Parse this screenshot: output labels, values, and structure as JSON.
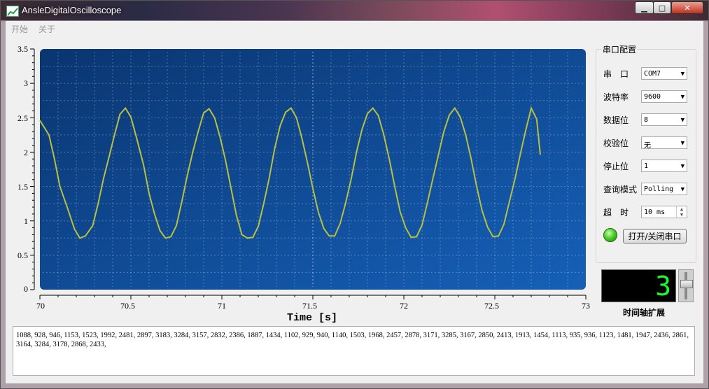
{
  "window": {
    "title": "AnsleDigitalOscilloscope",
    "minimize": "▁",
    "maximize": "□",
    "close": "✕"
  },
  "menu": {
    "items": [
      "开始",
      "关于"
    ]
  },
  "plot": {
    "x_label": "Time [s]",
    "x_ticks": [
      "70",
      "70.5",
      "71",
      "71.5",
      "72",
      "72.5",
      "73"
    ],
    "y_ticks": [
      "3.5",
      "3",
      "2.5",
      "2",
      "1.5",
      "1",
      "0.5",
      "0"
    ],
    "background": "#0a4a8c",
    "trace_color": "#b8c040"
  },
  "chart_data": {
    "type": "line",
    "xlabel": "Time [s]",
    "ylabel": "",
    "xlim": [
      70,
      73
    ],
    "ylim": [
      0,
      3.5
    ],
    "grid": true,
    "series": [
      {
        "x": [
          70.0,
          70.05,
          70.08,
          70.11,
          70.15,
          70.19,
          70.22,
          70.25,
          70.29,
          70.32,
          70.35,
          70.38,
          70.41,
          70.44,
          70.47,
          70.5,
          70.53,
          70.57,
          70.6,
          70.63,
          70.66,
          70.69,
          70.72,
          70.75,
          70.78,
          70.81,
          70.84,
          70.87,
          70.9,
          70.93,
          70.96,
          70.99,
          71.02,
          71.05,
          71.08,
          71.11,
          71.14,
          71.17,
          71.2,
          71.23,
          71.26,
          71.29,
          71.32,
          71.35,
          71.38,
          71.41,
          71.44,
          71.47,
          71.5,
          71.53,
          71.56,
          71.59,
          71.62,
          71.65,
          71.68,
          71.71,
          71.74,
          71.77,
          71.8,
          71.83,
          71.86,
          71.89,
          71.92,
          71.95,
          71.98,
          72.01,
          72.04,
          72.07,
          72.1,
          72.13,
          72.16,
          72.19,
          72.22,
          72.25,
          72.28,
          72.31,
          72.34,
          72.37,
          72.4,
          72.43,
          72.46,
          72.49,
          72.52,
          72.55,
          72.58,
          72.61,
          72.64,
          72.67,
          72.7,
          72.73,
          72.75
        ],
        "y": [
          2.46,
          2.25,
          1.9,
          1.5,
          1.2,
          0.88,
          0.75,
          0.78,
          0.93,
          1.25,
          1.62,
          1.93,
          2.25,
          2.55,
          2.64,
          2.51,
          2.22,
          1.81,
          1.4,
          1.1,
          0.86,
          0.75,
          0.77,
          0.93,
          1.28,
          1.66,
          2.0,
          2.3,
          2.57,
          2.63,
          2.5,
          2.22,
          1.88,
          1.48,
          1.08,
          0.8,
          0.75,
          0.76,
          0.92,
          1.25,
          1.62,
          2.05,
          2.38,
          2.58,
          2.64,
          2.5,
          2.2,
          1.85,
          1.47,
          1.13,
          0.89,
          0.78,
          0.78,
          0.96,
          1.26,
          1.6,
          2.0,
          2.33,
          2.56,
          2.64,
          2.53,
          2.25,
          1.9,
          1.5,
          1.13,
          0.9,
          0.76,
          0.77,
          0.94,
          1.27,
          1.62,
          1.96,
          2.3,
          2.54,
          2.64,
          2.51,
          2.25,
          1.9,
          1.5,
          1.15,
          0.91,
          0.77,
          0.78,
          0.95,
          1.28,
          1.6,
          1.97,
          2.32,
          2.64,
          2.48,
          1.96
        ]
      }
    ]
  },
  "serial_config": {
    "group_title": "串口配置",
    "rows": [
      {
        "label": "串　口",
        "value": "COM7"
      },
      {
        "label": "波特率",
        "value": "9600"
      },
      {
        "label": "数据位",
        "value": "8"
      },
      {
        "label": "校验位",
        "value": "无"
      },
      {
        "label": "停止位",
        "value": "1"
      },
      {
        "label": "查询模式",
        "value": "Polling"
      }
    ],
    "timeout": {
      "label": "超　时",
      "value": "10 ms"
    },
    "toggle_button": "打开/关闭串口",
    "led_color": "#4fd02a"
  },
  "timebase": {
    "digit": "3",
    "caption": "时间轴扩展",
    "lcd_color": "#13ff2a"
  },
  "data_text": "1088, 928, 946, 1153, 1523, 1992, 2481, 2897, 3183, 3284, 3157, 2832, 2386, 1887, 1434, 1102, 929, 940, 1140, 1503, 1968, 2457, 2878, 3171, 3285, 3167, 2850, 2413, 1913, 1454, 1113, 935, 936, 1123, 1481, 1947, 2436, 2861, 3164, 3284, 3178, 2868, 2433,"
}
